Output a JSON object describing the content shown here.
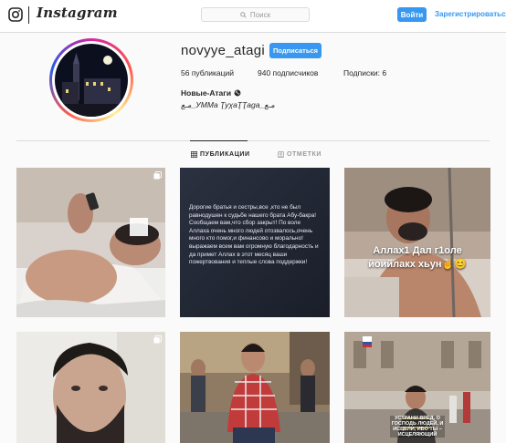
{
  "header": {
    "logo_text": "Instagram",
    "search_placeholder": "Поиск",
    "login_label": "Войти",
    "register_label": "Зарегистрироваться"
  },
  "profile": {
    "username": "novyye_atagi",
    "follow_label": "Подписаться",
    "stats": {
      "posts": "56 публикаций",
      "followers": "940 подписчиков",
      "following": "Подписки: 6"
    },
    "full_name": "Новые-Атаги",
    "bio": "مـع_УММа ƮуχаƮƮаgа_مـع"
  },
  "tabs": [
    {
      "label": "ПУБЛИКАЦИИ",
      "icon": "grid-icon",
      "active": true
    },
    {
      "label": "ОТМЕТКИ",
      "icon": "tagged-icon",
      "active": false
    }
  ],
  "posts": [
    {
      "text": "",
      "multi": true
    },
    {
      "text": "Дорогие братья и сестры,все ,кто не был равнодушен к судьбе нашего брата Абу-бакра!\nСообщаем вам,что сбор закрыт! По воле Аллаха очень много людей отозвалось,очень много кто помог,и финансово и морально!выражаем всем вам огромную благодарность и да примет Аллах в этот месяц ваши пожертвования и теплые слова поддержки!",
      "multi": false
    },
    {
      "text": "Аллах1 Дал г1оле\nйоийлакх хьун☝️😊",
      "multi": false
    },
    {
      "text": "",
      "multi": true
    },
    {
      "text": "",
      "multi": false
    },
    {
      "text": "УСТРАНИ ВРЕД, О ГОСПОДЬ ЛЮДЕЙ, И ИСЦЕЛИ, ИБО ТЫ – ИСЦЕЛЯЮЩИЙ",
      "multi": false
    }
  ],
  "colors": {
    "accent": "#3897f0",
    "border": "#dbdbdb",
    "text": "#262626",
    "muted": "#999999"
  }
}
